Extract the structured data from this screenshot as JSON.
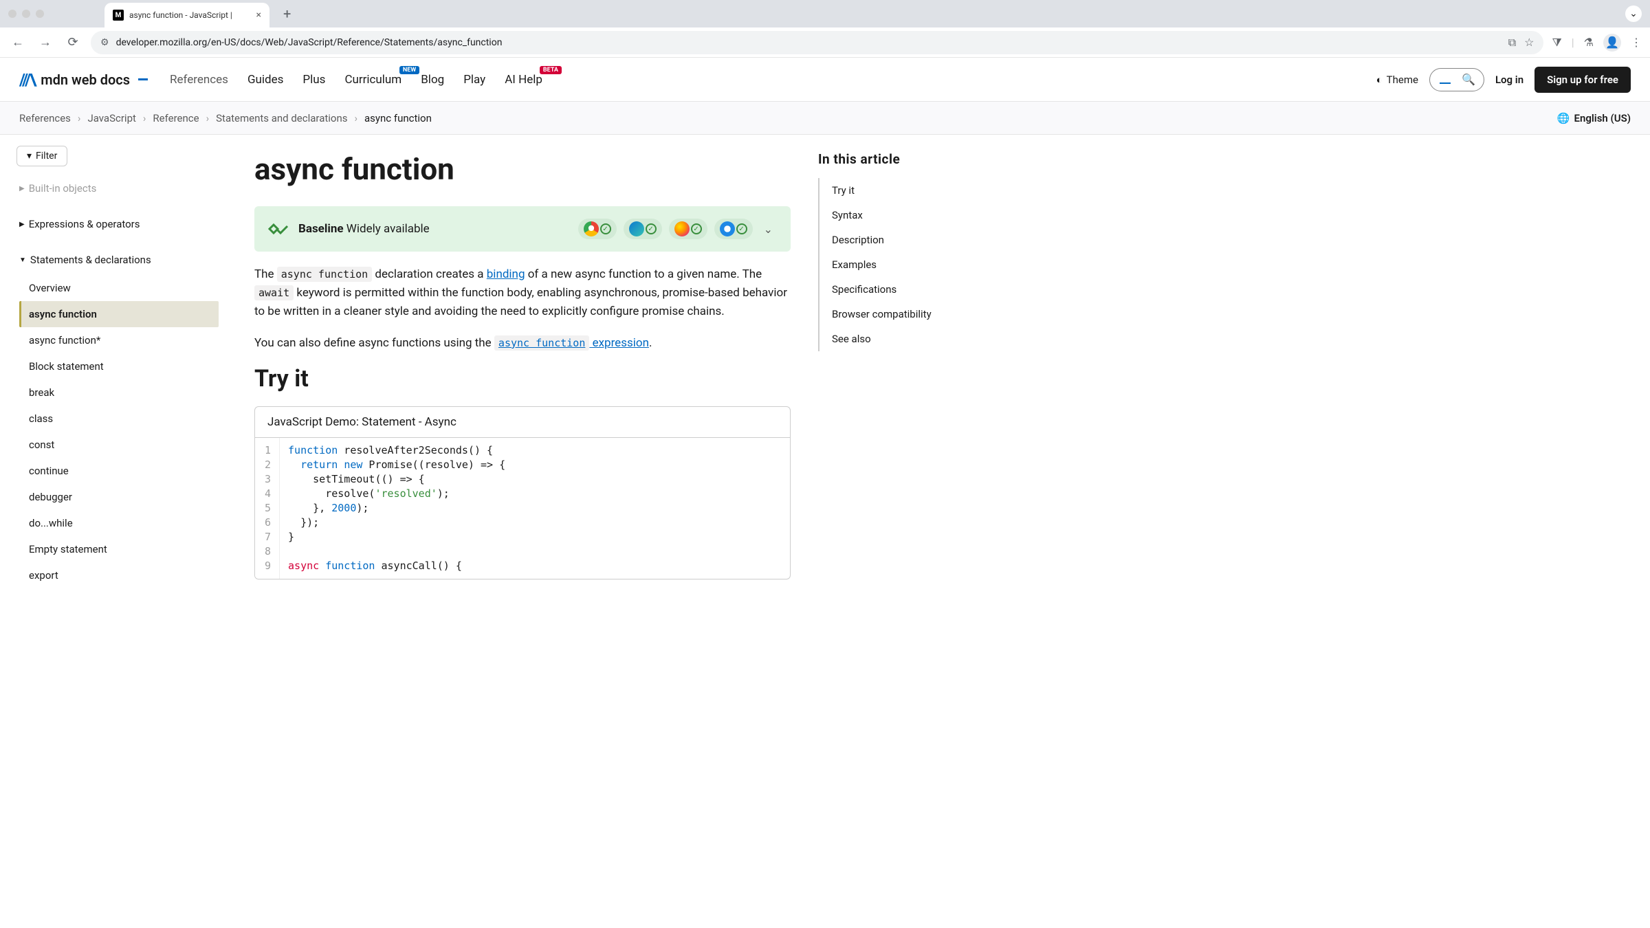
{
  "browser": {
    "tab_title": "async function - JavaScript |",
    "url": "developer.mozilla.org/en-US/docs/Web/JavaScript/Reference/Statements/async_function"
  },
  "header": {
    "logo_text": "mdn web docs",
    "nav": [
      "References",
      "Guides",
      "Plus",
      "Curriculum",
      "Blog",
      "Play",
      "AI Help"
    ],
    "badge_new": "NEW",
    "badge_beta": "BETA",
    "theme": "Theme",
    "login": "Log in",
    "signup": "Sign up for free"
  },
  "breadcrumbs": {
    "items": [
      "References",
      "JavaScript",
      "Reference",
      "Statements and declarations",
      "async function"
    ],
    "language": "English (US)"
  },
  "sidebar": {
    "filter": "Filter",
    "built_in": "Built-in objects",
    "expressions": "Expressions & operators",
    "statements": "Statements & declarations",
    "items": [
      "Overview",
      "async function",
      "async function*",
      "Block statement",
      "break",
      "class",
      "const",
      "continue",
      "debugger",
      "do...while",
      "Empty statement",
      "export"
    ]
  },
  "article": {
    "title": "async function",
    "baseline_label": "Baseline",
    "baseline_status": "Widely available",
    "intro_1a": "The ",
    "intro_code1": "async function",
    "intro_1b": " declaration creates a ",
    "intro_link1": "binding",
    "intro_1c": " of a new async function to a given name. The ",
    "intro_code2": "await",
    "intro_1d": " keyword is permitted within the function body, enabling asynchronous, promise-based behavior to be written in a cleaner style and avoiding the need to explicitly configure promise chains.",
    "intro_2a": "You can also define async functions using the ",
    "intro_link2_code": "async function",
    "intro_link2_text": " expression",
    "intro_2b": ".",
    "try_it": "Try it",
    "demo_title": "JavaScript Demo: Statement - Async"
  },
  "code": {
    "gutter": "1\n2\n3\n4\n5\n6\n7\n8\n9",
    "l1_a": "function",
    "l1_b": " resolveAfter2Seconds() {",
    "l2_a": "  ",
    "l2_b": "return",
    "l2_c": " ",
    "l2_d": "new",
    "l2_e": " Promise((resolve) => {",
    "l3": "    setTimeout(() => {",
    "l4_a": "      resolve(",
    "l4_b": "'resolved'",
    "l4_c": ");",
    "l5_a": "    }, ",
    "l5_b": "2000",
    "l5_c": ");",
    "l6": "  });",
    "l7": "}",
    "l8": "",
    "l9_a": "async",
    "l9_b": " ",
    "l9_c": "function",
    "l9_d": " asyncCall() {"
  },
  "toc": {
    "title": "In this article",
    "items": [
      "Try it",
      "Syntax",
      "Description",
      "Examples",
      "Specifications",
      "Browser compatibility",
      "See also"
    ]
  }
}
